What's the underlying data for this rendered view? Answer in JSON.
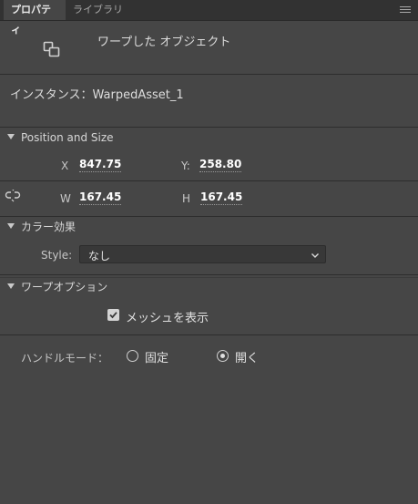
{
  "tabs": [
    {
      "label": "プロパティ",
      "active": true
    },
    {
      "label": "ライブラリ",
      "active": false
    }
  ],
  "panel_menu_icon": "hamburger-menu-icon",
  "symbol": {
    "icon": "warp-object-icon",
    "type_label": "ワープした オブジェクト"
  },
  "instance": {
    "label": "インスタンス：",
    "name": "WarpedAsset_1"
  },
  "position_size": {
    "title": "Position and Size",
    "x_label": "X",
    "x_value": "847.75",
    "y_label": "Y:",
    "y_value": "258.80",
    "link_icon": "link-icon",
    "w_label": "W",
    "w_value": "167.45",
    "h_label": "H",
    "h_value": "167.45"
  },
  "color_effect": {
    "title": "カラー効果",
    "style_label": "Style:",
    "style_value": "なし"
  },
  "warp_options": {
    "title": "ワープオプション",
    "show_mesh_label": "メッシュを表示",
    "show_mesh_checked": true,
    "handle_mode_label": "ハンドルモード：",
    "option_fixed": "固定",
    "option_open": "開く",
    "selected": "開く"
  },
  "colors": {
    "panel_bg": "#464646",
    "tabbar_bg": "#323232",
    "value_text": "#ffffff"
  }
}
